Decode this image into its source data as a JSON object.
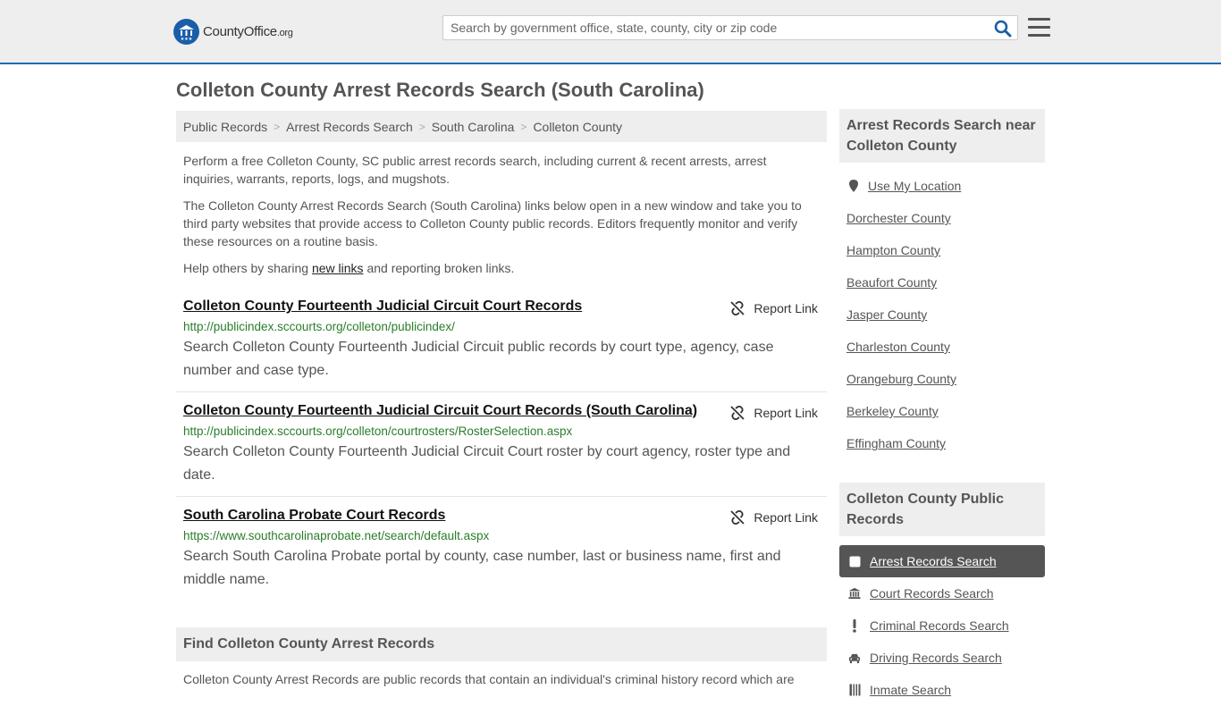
{
  "header": {
    "logo_name": "CountyOffice",
    "logo_tld": ".org",
    "search_placeholder": "Search by government office, state, county, city or zip code"
  },
  "page_title": "Colleton County Arrest Records Search (South Carolina)",
  "breadcrumb": [
    "Public Records",
    "Arrest Records Search",
    "South Carolina",
    "Colleton County"
  ],
  "intro": {
    "p1": "Perform a free Colleton County, SC public arrest records search, including current & recent arrests, arrest inquiries, warrants, reports, logs, and mugshots.",
    "p2": "The Colleton County Arrest Records Search (South Carolina) links below open in a new window and take you to third party websites that provide access to Colleton County public records. Editors frequently monitor and verify these resources on a routine basis.",
    "p3_before": "Help others by sharing ",
    "p3_link": "new links",
    "p3_after": " and reporting broken links."
  },
  "report_label": "Report Link",
  "results": [
    {
      "title": "Colleton County Fourteenth Judicial Circuit Court Records",
      "url": "http://publicindex.sccourts.org/colleton/publicindex/",
      "desc": "Search Colleton County Fourteenth Judicial Circuit public records by court type, agency, case number and case type."
    },
    {
      "title": "Colleton County Fourteenth Judicial Circuit Court Records (South Carolina)",
      "url": "http://publicindex.sccourts.org/colleton/courtrosters/RosterSelection.aspx",
      "desc": "Search Colleton County Fourteenth Judicial Circuit Court roster by court agency, roster type and date."
    },
    {
      "title": "South Carolina Probate Court Records",
      "url": "https://www.southcarolinaprobate.net/search/default.aspx",
      "desc": "Search South Carolina Probate portal by county, case number, last or business name, first and middle name."
    }
  ],
  "find": {
    "heading": "Find Colleton County Arrest Records",
    "text": "Colleton County Arrest Records are public records that contain an individual's criminal history record which are"
  },
  "sidebar": {
    "near_heading": "Arrest Records Search near Colleton County",
    "near_items": [
      "Use My Location",
      "Dorchester County",
      "Hampton County",
      "Beaufort County",
      "Jasper County",
      "Charleston County",
      "Orangeburg County",
      "Berkeley County",
      "Effingham County"
    ],
    "public_heading": "Colleton County Public Records",
    "public_items": [
      {
        "label": "Arrest Records Search",
        "icon": "square-icon",
        "active": true
      },
      {
        "label": "Court Records Search",
        "icon": "courthouse-icon",
        "active": false
      },
      {
        "label": "Criminal Records Search",
        "icon": "exclamation-icon",
        "active": false
      },
      {
        "label": "Driving Records Search",
        "icon": "car-icon",
        "active": false
      },
      {
        "label": "Inmate Search",
        "icon": "inmate-icon",
        "active": false
      }
    ]
  },
  "colors": {
    "header_bg": "#eeeeee",
    "header_border": "#1e6ab3",
    "search_icon": "#1a5ea8",
    "url_green": "#2a7d2a",
    "active_item_bg": "#555555"
  }
}
